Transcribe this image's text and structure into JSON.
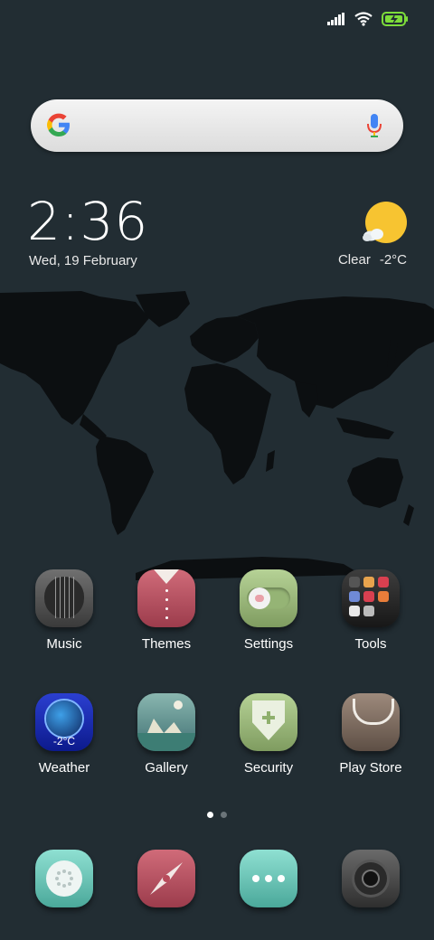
{
  "status": {
    "signal_icon": "signal-bars-icon",
    "wifi_icon": "wifi-icon",
    "battery_icon": "battery-charging-icon"
  },
  "search": {
    "logo_icon": "google-g-icon",
    "mic_icon": "mic-icon"
  },
  "clock": {
    "time": "2:36",
    "date": "Wed, 19 February"
  },
  "weather_widget": {
    "condition": "Clear",
    "temperature": "-2°C",
    "icon": "sun-cloud-icon"
  },
  "apps_row1": [
    {
      "label": "Music",
      "icon": "guitar-icon"
    },
    {
      "label": "Themes",
      "icon": "shirt-icon"
    },
    {
      "label": "Settings",
      "icon": "toggle-icon"
    },
    {
      "label": "Tools",
      "icon": "folder-icon"
    }
  ],
  "apps_row2": [
    {
      "label": "Weather",
      "icon": "globe-icon",
      "badge": "-2°C"
    },
    {
      "label": "Gallery",
      "icon": "mountain-icon"
    },
    {
      "label": "Security",
      "icon": "shield-icon"
    },
    {
      "label": "Play Store",
      "icon": "bag-icon"
    }
  ],
  "dock": [
    {
      "icon": "phone-icon"
    },
    {
      "icon": "browser-icon"
    },
    {
      "icon": "messages-icon"
    },
    {
      "icon": "camera-icon"
    }
  ],
  "page_indicator": {
    "count": 2,
    "active": 0
  },
  "colors": {
    "background": "#222d33",
    "map": "#0c0f11"
  }
}
